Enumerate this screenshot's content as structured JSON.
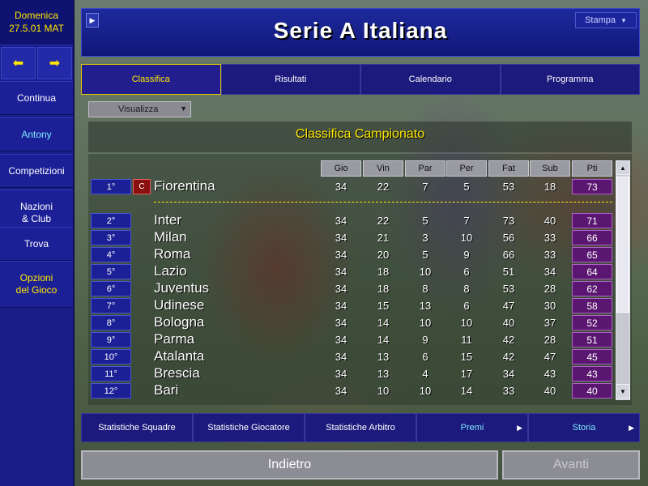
{
  "sidebar": {
    "date_line1": "Domenica",
    "date_line2": "27.5.01 MAT",
    "back_arrow": "arrow-left-icon",
    "forward_arrow": "arrow-right-icon",
    "items": [
      {
        "label": "Continua"
      },
      {
        "label": "Antony"
      },
      {
        "label": "Competizioni"
      },
      {
        "label_line1": "Nazioni",
        "label_line2": "& Club"
      },
      {
        "label": "Trova"
      },
      {
        "label_line1": "Opzioni",
        "label_line2": "del Gioco"
      }
    ]
  },
  "header": {
    "title": "Serie A Italiana",
    "stampa_label": "Stampa"
  },
  "tabs": [
    {
      "label": "Classifica",
      "active": true
    },
    {
      "label": "Risultati"
    },
    {
      "label": "Calendario"
    },
    {
      "label": "Programma"
    }
  ],
  "view_dropdown": {
    "label": "Visualizza"
  },
  "table": {
    "title": "Classifica Campionato",
    "columns": [
      "Gio",
      "Vin",
      "Par",
      "Per",
      "Fat",
      "Sub",
      "Pti"
    ],
    "champion_badge": "C",
    "rows": [
      {
        "pos": "1°",
        "team": "Fiorentina",
        "gio": "34",
        "vin": "22",
        "par": "7",
        "per": "5",
        "fat": "53",
        "sub": "18",
        "pti": "73"
      },
      {
        "pos": "2°",
        "team": "Inter",
        "gio": "34",
        "vin": "22",
        "par": "5",
        "per": "7",
        "fat": "73",
        "sub": "40",
        "pti": "71"
      },
      {
        "pos": "3°",
        "team": "Milan",
        "gio": "34",
        "vin": "21",
        "par": "3",
        "per": "10",
        "fat": "56",
        "sub": "33",
        "pti": "66"
      },
      {
        "pos": "4°",
        "team": "Roma",
        "gio": "34",
        "vin": "20",
        "par": "5",
        "per": "9",
        "fat": "66",
        "sub": "33",
        "pti": "65"
      },
      {
        "pos": "5°",
        "team": "Lazio",
        "gio": "34",
        "vin": "18",
        "par": "10",
        "per": "6",
        "fat": "51",
        "sub": "34",
        "pti": "64"
      },
      {
        "pos": "6°",
        "team": "Juventus",
        "gio": "34",
        "vin": "18",
        "par": "8",
        "per": "8",
        "fat": "53",
        "sub": "28",
        "pti": "62"
      },
      {
        "pos": "7°",
        "team": "Udinese",
        "gio": "34",
        "vin": "15",
        "par": "13",
        "per": "6",
        "fat": "47",
        "sub": "30",
        "pti": "58"
      },
      {
        "pos": "8°",
        "team": "Bologna",
        "gio": "34",
        "vin": "14",
        "par": "10",
        "per": "10",
        "fat": "40",
        "sub": "37",
        "pti": "52"
      },
      {
        "pos": "9°",
        "team": "Parma",
        "gio": "34",
        "vin": "14",
        "par": "9",
        "per": "11",
        "fat": "42",
        "sub": "28",
        "pti": "51"
      },
      {
        "pos": "10°",
        "team": "Atalanta",
        "gio": "34",
        "vin": "13",
        "par": "6",
        "per": "15",
        "fat": "42",
        "sub": "47",
        "pti": "45"
      },
      {
        "pos": "11°",
        "team": "Brescia",
        "gio": "34",
        "vin": "13",
        "par": "4",
        "per": "17",
        "fat": "34",
        "sub": "43",
        "pti": "43"
      },
      {
        "pos": "12°",
        "team": "Bari",
        "gio": "34",
        "vin": "10",
        "par": "10",
        "per": "14",
        "fat": "33",
        "sub": "40",
        "pti": "40"
      }
    ]
  },
  "stats_buttons": [
    {
      "label": "Statistiche Squadre"
    },
    {
      "label": "Statistiche Giocatore"
    },
    {
      "label": "Statistiche Arbitro"
    },
    {
      "label": "Premi"
    },
    {
      "label": "Storia"
    }
  ],
  "footer": {
    "back_label": "Indietro",
    "next_label": "Avanti"
  },
  "colors": {
    "sidebar": "#1a1e8a",
    "accent_yellow": "#ffe800",
    "accent_cyan": "#7fe8ff",
    "points_cell": "#5a1670"
  }
}
